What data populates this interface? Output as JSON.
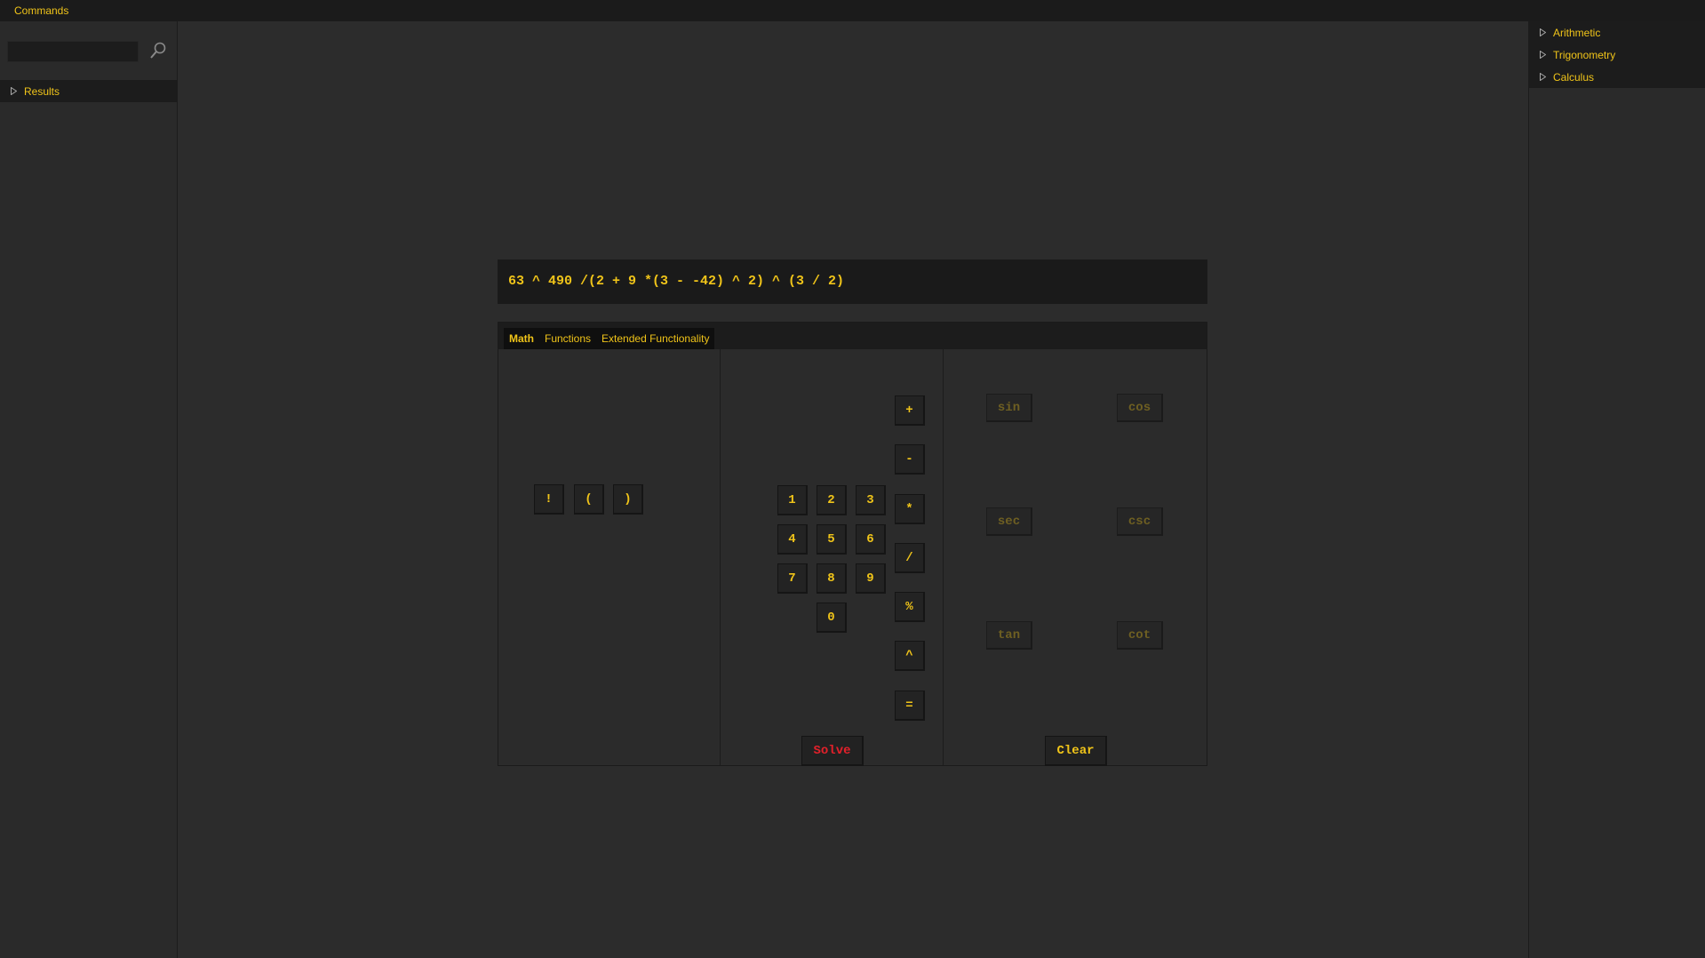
{
  "menubar": {
    "commands_label": "Commands"
  },
  "left_panel": {
    "search": {
      "value": "",
      "placeholder": ""
    },
    "tree": [
      {
        "label": "Results"
      }
    ]
  },
  "right_panel": {
    "items": [
      {
        "label": "Arithmetic"
      },
      {
        "label": "Trigonometry"
      },
      {
        "label": "Calculus"
      }
    ]
  },
  "expression": "63 ^ 490 /(2 + 9 *(3 - -42) ^ 2) ^ (3 / 2)",
  "tabs": [
    {
      "label": "Math",
      "active": true
    },
    {
      "label": "Functions",
      "active": false
    },
    {
      "label": "Extended Functionality",
      "active": false
    }
  ],
  "misc_keys": [
    "!",
    "(",
    ")"
  ],
  "digits": [
    "1",
    "2",
    "3",
    "4",
    "5",
    "6",
    "7",
    "8",
    "9",
    "0"
  ],
  "operators": [
    "+",
    "-",
    "*",
    "/",
    "%",
    "^",
    "="
  ],
  "solve_label": "Solve",
  "clear_label": "Clear",
  "trig": [
    "sin",
    "cos",
    "sec",
    "csc",
    "tan",
    "cot"
  ],
  "colors": {
    "accent": "#f0c419",
    "solve": "#e3202a",
    "disabled": "#6e5f22",
    "background": "#2c2c2c"
  }
}
